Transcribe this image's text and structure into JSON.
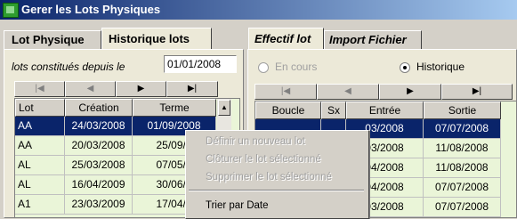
{
  "window": {
    "title": "Gerer les Lots Physiques"
  },
  "left": {
    "tabs": [
      {
        "label": "Lot Physique"
      },
      {
        "label": "Historique lots"
      }
    ],
    "filter_label": "lots constitués depuis le",
    "filter_date": "01/01/2008",
    "nav": [
      "|◀",
      "◀",
      "▶",
      "▶|"
    ],
    "columns": [
      "Lot",
      "Création",
      "Terme"
    ],
    "rows": [
      {
        "lot": "AA",
        "creation": "24/03/2008",
        "terme": "01/09/2008"
      },
      {
        "lot": "AA",
        "creation": "20/03/2008",
        "terme": "25/09/2"
      },
      {
        "lot": "AL",
        "creation": "25/03/2008",
        "terme": "07/05/2"
      },
      {
        "lot": "AL",
        "creation": "16/04/2009",
        "terme": "30/06/2"
      },
      {
        "lot": "A1",
        "creation": "23/03/2009",
        "terme": "17/04/2"
      }
    ]
  },
  "right": {
    "tabs": [
      {
        "label": "Effectif lot"
      },
      {
        "label": "Import Fichier"
      }
    ],
    "radios": [
      {
        "label": "En cours",
        "checked": false
      },
      {
        "label": "Historique",
        "checked": true
      }
    ],
    "nav": [
      "|◀",
      "◀",
      "▶",
      "▶|"
    ],
    "columns": [
      "Boucle",
      "Sx",
      "Entrée",
      "Sortie"
    ],
    "rows": [
      {
        "boucle": "",
        "sx": "",
        "entree": "03/2008",
        "sortie": "07/07/2008"
      },
      {
        "boucle": "",
        "sx": "",
        "entree": "03/2008",
        "sortie": "11/08/2008"
      },
      {
        "boucle": "",
        "sx": "",
        "entree": "04/2008",
        "sortie": "11/08/2008"
      },
      {
        "boucle": "",
        "sx": "",
        "entree": "04/2008",
        "sortie": "07/07/2008"
      },
      {
        "boucle": "",
        "sx": "",
        "entree": "03/2008",
        "sortie": "07/07/2008"
      }
    ]
  },
  "context_menu": {
    "items": [
      {
        "label": "Définir un nouveau lot",
        "enabled": false
      },
      {
        "label": "Clôturer le lot sélectionné",
        "enabled": false
      },
      {
        "label": "Supprimer le lot sélectionné",
        "enabled": false
      },
      {
        "label": "Trier par Date",
        "enabled": true
      }
    ]
  }
}
